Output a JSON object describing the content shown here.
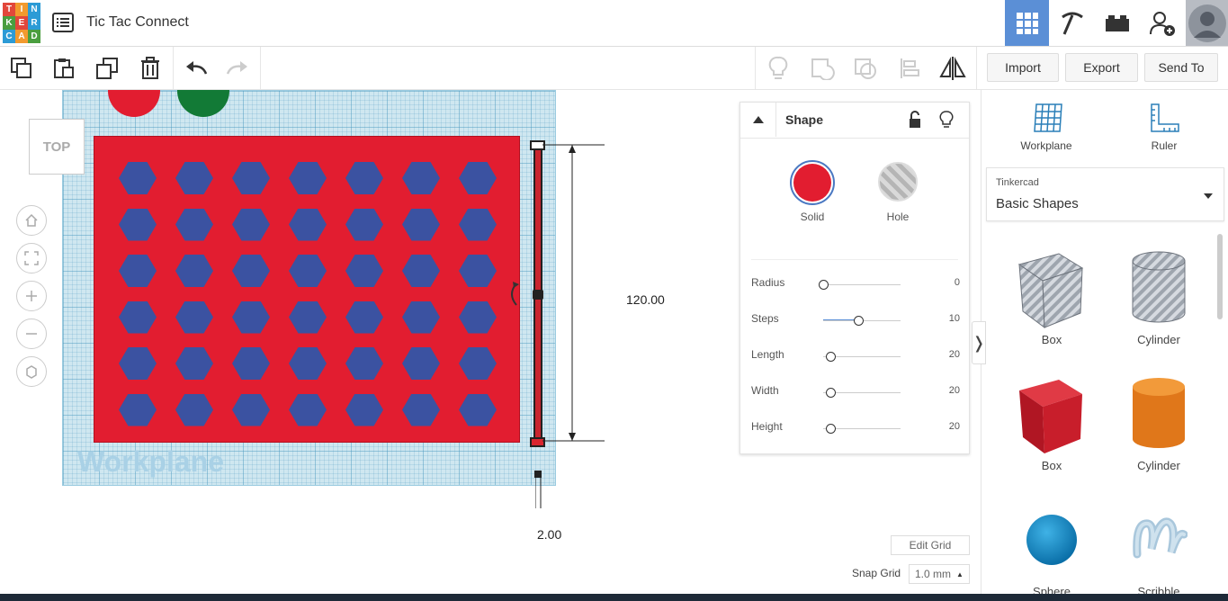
{
  "app": {
    "logo_letters": [
      "T",
      "I",
      "N",
      "K",
      "E",
      "R",
      "C",
      "A",
      "D"
    ],
    "design_title": "Tic Tac Connect"
  },
  "top_nav": {
    "icons": [
      "3d-design-icon",
      "codeblocks-icon",
      "bricks-icon",
      "add-user-icon",
      "avatar"
    ]
  },
  "toolbar": {
    "import_label": "Import",
    "export_label": "Export",
    "send_to_label": "Send To"
  },
  "canvas": {
    "view_cube_label": "TOP",
    "workplane_label": "Workplane",
    "dim_height": "120.00",
    "dim_width": "2.00",
    "edit_grid_label": "Edit Grid",
    "snap_grid_label": "Snap Grid",
    "snap_grid_value": "1.0 mm",
    "hex_rows": 6,
    "hex_cols": 7
  },
  "inspector": {
    "title": "Shape",
    "solid_label": "Solid",
    "hole_label": "Hole",
    "props": [
      {
        "label": "Radius",
        "value": "0",
        "fraction": 0.0
      },
      {
        "label": "Steps",
        "value": "10",
        "fraction": 0.45
      },
      {
        "label": "Length",
        "value": "20",
        "fraction": 0.09
      },
      {
        "label": "Width",
        "value": "20",
        "fraction": 0.09
      },
      {
        "label": "Height",
        "value": "20",
        "fraction": 0.09
      }
    ]
  },
  "right_panel": {
    "workplane_label": "Workplane",
    "ruler_label": "Ruler",
    "library_source": "Tinkercad",
    "library_name": "Basic Shapes",
    "shapes": [
      {
        "label": "Box"
      },
      {
        "label": "Cylinder"
      },
      {
        "label": "Box"
      },
      {
        "label": "Cylinder"
      },
      {
        "label": "Sphere"
      },
      {
        "label": "Scribble"
      }
    ]
  },
  "colors": {
    "accent_blue": "#5b8fd6",
    "board_red": "#e21d30",
    "hex_blue": "#3b52a1"
  }
}
